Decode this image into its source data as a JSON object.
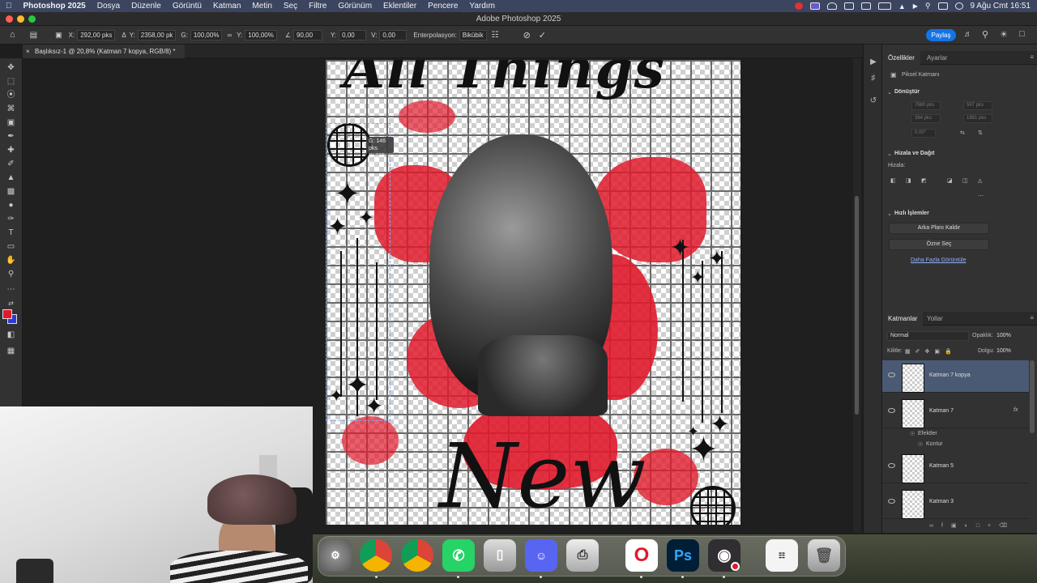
{
  "menubar": {
    "app": "Photoshop 2025",
    "items": [
      "Dosya",
      "Düzenle",
      "Görüntü",
      "Katman",
      "Metin",
      "Seç",
      "Filtre",
      "Görünüm",
      "Eklentiler",
      "Pencere",
      "Yardım"
    ],
    "datetime": "9 Ağu Cmt  16:51"
  },
  "window": {
    "title": "Adobe Photoshop 2025"
  },
  "options": {
    "x_label": "X:",
    "x_value": "292,00 pks",
    "y_label": "Y:",
    "y_value": "2358,00 pk",
    "w_label": "G:",
    "w_value": "100,00%",
    "h_label": "Y:",
    "h_value": "100,00%",
    "angle_value": "90,00",
    "hskew_label": "Y:",
    "hskew_value": "0,00",
    "vskew_label": "V:",
    "vskew_value": "0,00",
    "interp_label": "Enterpolasyon:",
    "interp_value": "Bikübik",
    "share_label": "Paylaş"
  },
  "document": {
    "tab_title": "Başlıksız-1 @ 20,8% (Katman 7 kopya, RGB/8) *",
    "poster_top_text": "All Things",
    "poster_bottom_text": "New",
    "tooltip_line1": "G: 146 pks",
    "tooltip_line2": "Y: 215 pks"
  },
  "properties": {
    "tab_properties": "Özellikler",
    "tab_adjustments": "Ayarlar",
    "layer_type": "Piksel Katmanı",
    "transform_title": "Dönüştür",
    "w_field": "7680 pks",
    "h_field": "597 pks",
    "x_field": "384 pks",
    "y_field": "1881 pks",
    "angle_field": "0,00°",
    "align_title": "Hizala ve Dağıt",
    "align_label": "Hizala:",
    "quick_title": "Hızlı İşlemler",
    "remove_bg_button": "Arka Planı Kaldır",
    "select_subject_button": "Özne Seç",
    "more_link": "Daha Fazla Görüntüle"
  },
  "layers_panel": {
    "tab_layers": "Katmanlar",
    "tab_paths": "Yollar",
    "blend_mode": "Normal",
    "opacity_label": "Opaklık:",
    "opacity_value": "100%",
    "lock_label": "Kilitle:",
    "fill_label": "Dolgu:",
    "fill_value": "100%",
    "layers": [
      "Katman 7 kopya",
      "Katman 7",
      "Katman 5",
      "Katman 3"
    ],
    "effects_label": "Efektler",
    "stroke_label": "Kontur",
    "fx_label": "fx"
  },
  "dock": {
    "apps": [
      "Sistem Ayarları",
      "Chrome",
      "Chrome",
      "WhatsApp",
      "iPhone Yansıtma",
      "Discord",
      "Yazıcı",
      "Opera",
      "Photoshop",
      "OBS"
    ],
    "ps_label": "Ps",
    "opera_label": "O"
  },
  "colors": {
    "accent": "#1473e6",
    "splatter": "#e01a2b",
    "foreground": "#e01a2b",
    "background": "#2a3bd6"
  }
}
